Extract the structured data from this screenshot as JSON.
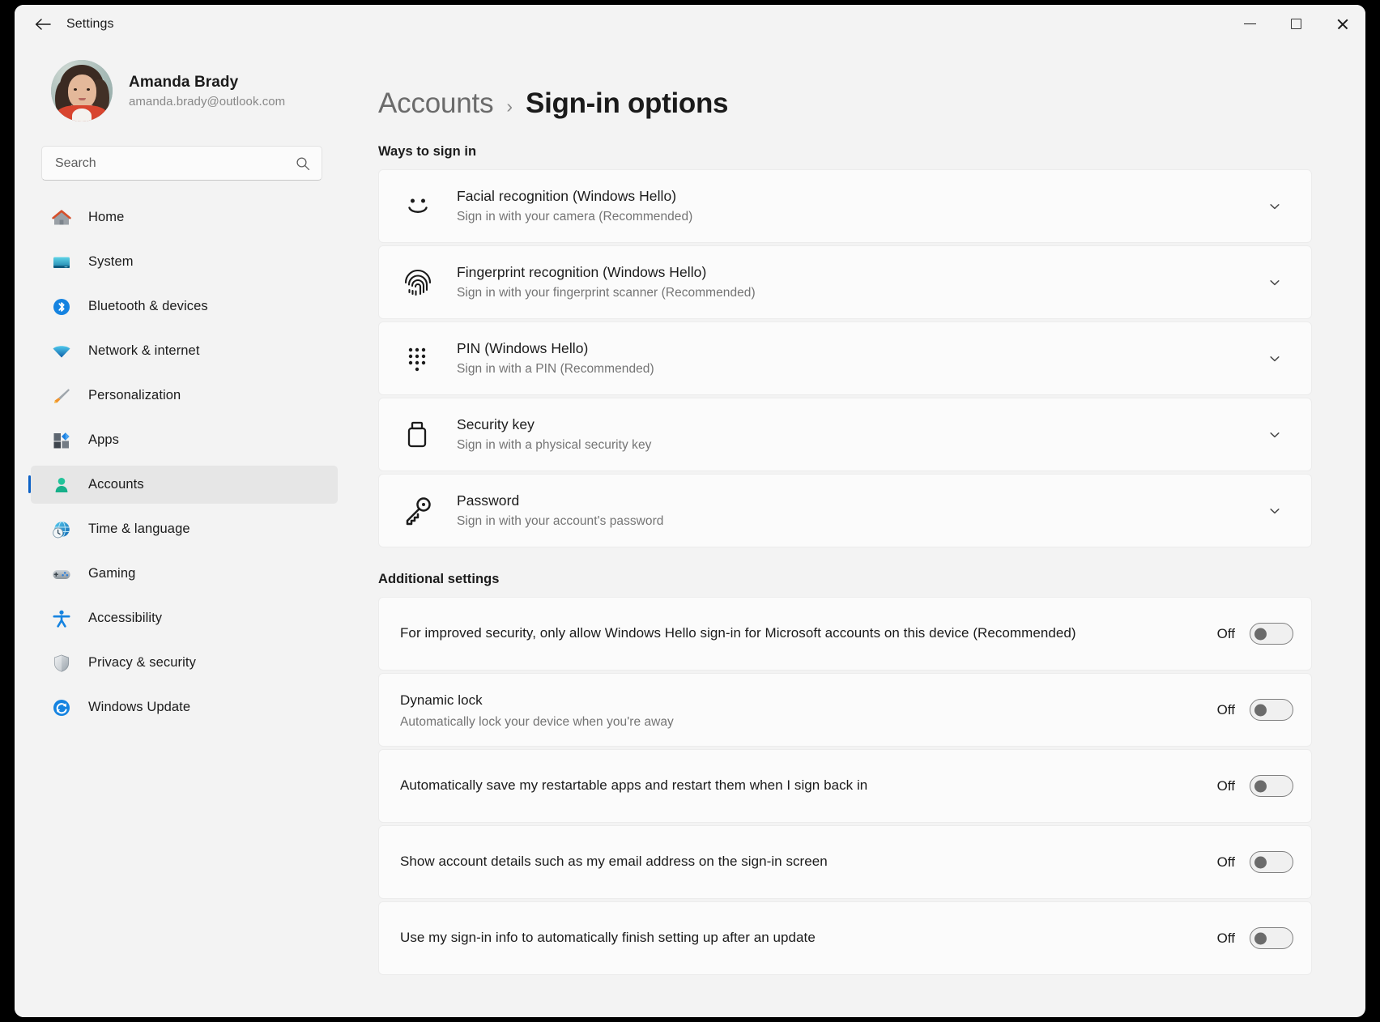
{
  "window": {
    "titlebar_text": "Settings",
    "back_icon": "back-arrow-icon",
    "minimize_label": "Minimize",
    "maximize_label": "Maximize",
    "close_label": "Close"
  },
  "accent_color": "#0d62c6",
  "sidebar": {
    "profile": {
      "name": "Amanda Brady",
      "email": "amanda.brady@outlook.com"
    },
    "search": {
      "placeholder": "Search",
      "icon": "search-icon"
    },
    "items": [
      {
        "label": "Home",
        "icon": "home-icon",
        "selected": false
      },
      {
        "label": "System",
        "icon": "system-icon",
        "selected": false
      },
      {
        "label": "Bluetooth & devices",
        "icon": "bluetooth-icon",
        "selected": false
      },
      {
        "label": "Network & internet",
        "icon": "wifi-icon",
        "selected": false
      },
      {
        "label": "Personalization",
        "icon": "brush-icon",
        "selected": false
      },
      {
        "label": "Apps",
        "icon": "apps-icon",
        "selected": false
      },
      {
        "label": "Accounts",
        "icon": "accounts-icon",
        "selected": true
      },
      {
        "label": "Time & language",
        "icon": "clock-globe-icon",
        "selected": false
      },
      {
        "label": "Gaming",
        "icon": "gamepad-icon",
        "selected": false
      },
      {
        "label": "Accessibility",
        "icon": "accessibility-icon",
        "selected": false
      },
      {
        "label": "Privacy & security",
        "icon": "shield-icon",
        "selected": false
      },
      {
        "label": "Windows Update",
        "icon": "update-icon",
        "selected": false
      }
    ]
  },
  "main": {
    "breadcrumb": {
      "parent": "Accounts",
      "separator": "›",
      "current": "Sign-in options"
    },
    "ways_section_title": "Ways to sign in",
    "signin_options": [
      {
        "title": "Facial recognition (Windows Hello)",
        "subtitle": "Sign in with your camera (Recommended)",
        "icon": "face-smile-icon",
        "expand_icon": "chevron-down-icon"
      },
      {
        "title": "Fingerprint recognition (Windows Hello)",
        "subtitle": "Sign in with your fingerprint scanner (Recommended)",
        "icon": "fingerprint-icon",
        "expand_icon": "chevron-down-icon"
      },
      {
        "title": "PIN (Windows Hello)",
        "subtitle": "Sign in with a PIN (Recommended)",
        "icon": "pin-keypad-icon",
        "expand_icon": "chevron-down-icon"
      },
      {
        "title": "Security key",
        "subtitle": "Sign in with a physical security key",
        "icon": "security-key-icon",
        "expand_icon": "chevron-down-icon"
      },
      {
        "title": "Password",
        "subtitle": "Sign in with your account's password",
        "icon": "key-icon",
        "expand_icon": "chevron-down-icon"
      }
    ],
    "additional_section_title": "Additional settings",
    "additional_settings": [
      {
        "title": "For improved security, only allow Windows Hello sign-in for Microsoft accounts on this device (Recommended)",
        "subtitle": "",
        "state": "Off"
      },
      {
        "title": "Dynamic lock",
        "subtitle": "Automatically lock your device when you're away",
        "state": "Off"
      },
      {
        "title": "Automatically save my restartable apps and restart them when I sign back in",
        "subtitle": "",
        "state": "Off"
      },
      {
        "title": "Show account details such as my email address on the sign-in screen",
        "subtitle": "",
        "state": "Off"
      },
      {
        "title": "Use my sign-in info to automatically finish setting up after an update",
        "subtitle": "",
        "state": "Off"
      }
    ]
  }
}
